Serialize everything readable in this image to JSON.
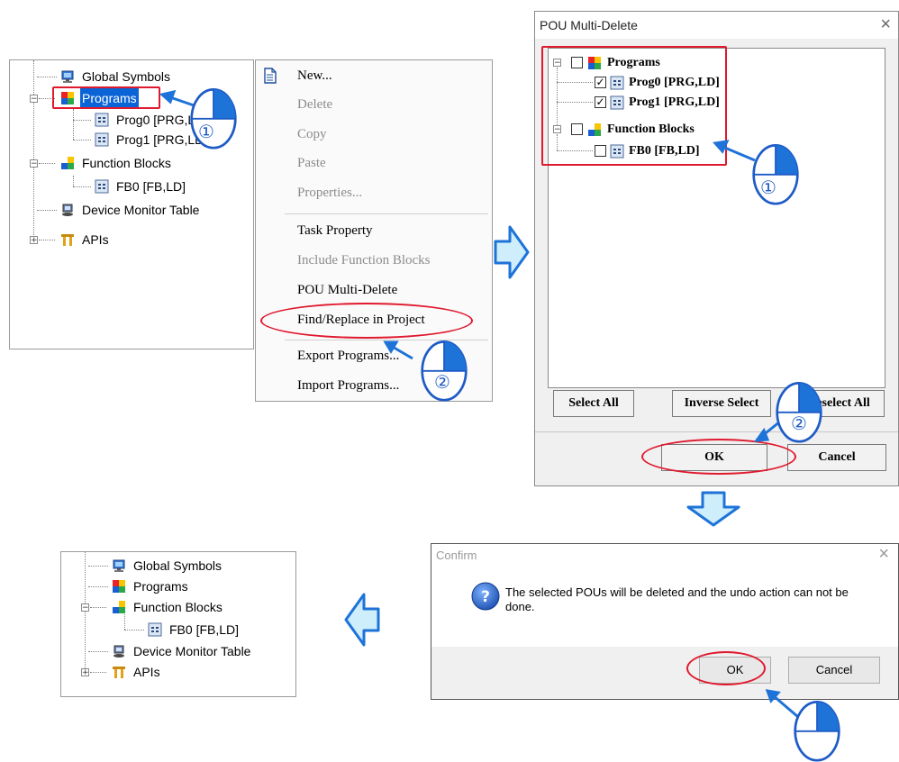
{
  "tree_before": {
    "items": [
      {
        "label": "Global Symbols",
        "icon": "global-symbols-icon"
      },
      {
        "label": "Programs",
        "icon": "programs-icon"
      },
      {
        "label": "Prog0 [PRG,LD]",
        "icon": "pou-icon"
      },
      {
        "label": "Prog1 [PRG,LD]",
        "icon": "pou-icon"
      },
      {
        "label": "Function Blocks",
        "icon": "function-blocks-icon"
      },
      {
        "label": "FB0 [FB,LD]",
        "icon": "pou-icon"
      },
      {
        "label": "Device Monitor Table",
        "icon": "device-monitor-icon"
      },
      {
        "label": "APIs",
        "icon": "apis-icon"
      }
    ]
  },
  "context_menu": {
    "items": [
      {
        "label": "New...",
        "enabled": true
      },
      {
        "label": "Delete",
        "enabled": false
      },
      {
        "label": "Copy",
        "enabled": false
      },
      {
        "label": "Paste",
        "enabled": false
      },
      {
        "label": "Properties...",
        "enabled": false
      },
      {
        "label": "Task Property",
        "enabled": true
      },
      {
        "label": "Include Function Blocks",
        "enabled": false
      },
      {
        "label": "POU Multi-Delete",
        "enabled": true
      },
      {
        "label": "Find/Replace in Project",
        "enabled": true
      },
      {
        "label": "Export Programs...",
        "enabled": true
      },
      {
        "label": "Import Programs...",
        "enabled": true
      }
    ]
  },
  "multi_delete_dialog": {
    "title": "POU Multi-Delete",
    "close": "×",
    "tree": [
      {
        "label": "Programs",
        "checked": false
      },
      {
        "label": "Prog0 [PRG,LD]",
        "checked": true
      },
      {
        "label": "Prog1 [PRG,LD]",
        "checked": true
      },
      {
        "label": "Function Blocks",
        "checked": false
      },
      {
        "label": "FB0 [FB,LD]",
        "checked": false
      }
    ],
    "select_all": "Select All",
    "inverse_select": "Inverse Select",
    "deselect_all": "Deselect All",
    "ok": "OK",
    "cancel": "Cancel"
  },
  "confirm_dialog": {
    "title": "Confirm",
    "close": "×",
    "message": "The selected POUs will be deleted and the undo action can not be done.",
    "ok": "OK",
    "cancel": "Cancel"
  },
  "tree_after": {
    "items": [
      {
        "label": "Global Symbols",
        "icon": "global-symbols-icon"
      },
      {
        "label": "Programs",
        "icon": "programs-icon"
      },
      {
        "label": "Function Blocks",
        "icon": "function-blocks-icon"
      },
      {
        "label": "FB0 [FB,LD]",
        "icon": "pou-icon"
      },
      {
        "label": "Device Monitor Table",
        "icon": "device-monitor-icon"
      },
      {
        "label": "APIs",
        "icon": "apis-icon"
      }
    ]
  },
  "callouts": {
    "step1": "①",
    "step2": "②"
  },
  "colors": {
    "highlight_red": "#e0192e",
    "arrow_blue": "#1e73d8",
    "arrow_fill": "#cdeefa",
    "selection_blue": "#0a64d6"
  }
}
